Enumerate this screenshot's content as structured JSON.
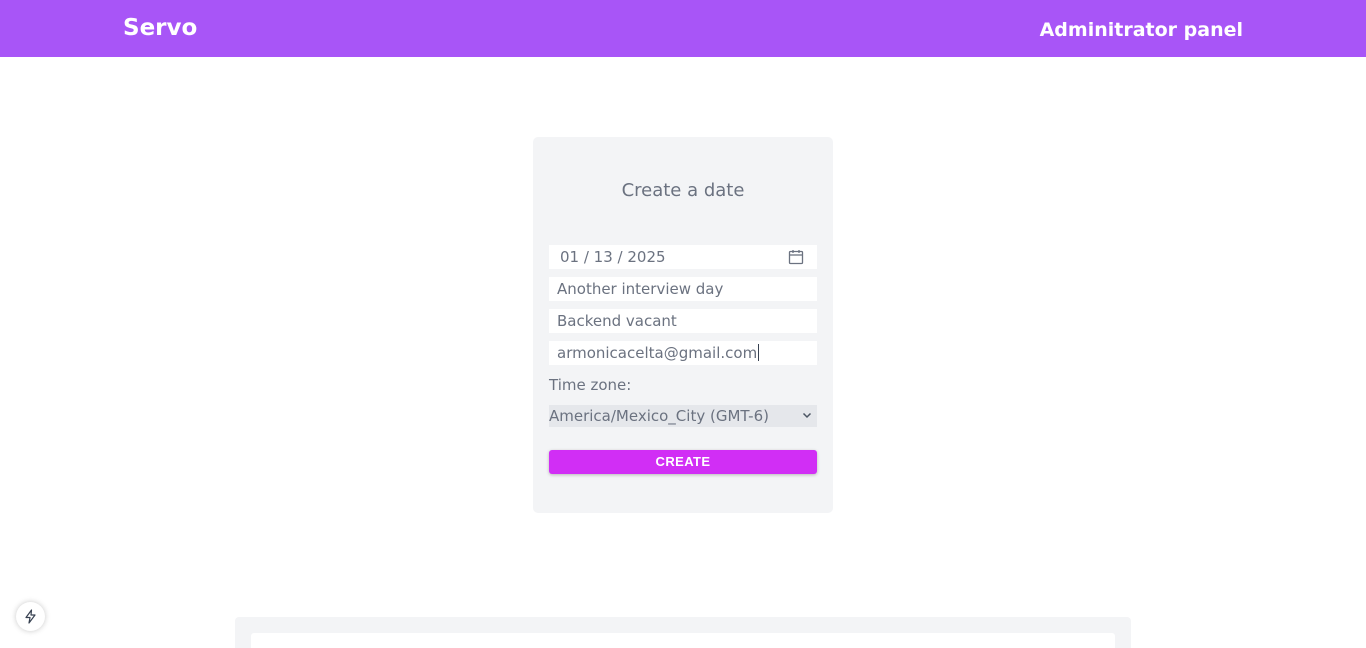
{
  "header": {
    "brand": "Servo",
    "admin_link": "Adminitrator panel"
  },
  "form": {
    "title": "Create a date",
    "date_value": "01 / 13 / 2025",
    "title_value": "Another interview day",
    "vacant_value": "Backend vacant",
    "email_value": "armonicacelta@gmail.com",
    "timezone_label": "Time zone:",
    "timezone_value": "America/Mexico_City (GMT-6)",
    "create_label": "CREATE"
  },
  "icons": {
    "date": "calendar-icon",
    "select": "chevron-down-icon",
    "floating": "bolt-icon"
  },
  "colors": {
    "header": "#a855f7",
    "create_button": "#d12ef5",
    "card": "#f3f4f6"
  }
}
